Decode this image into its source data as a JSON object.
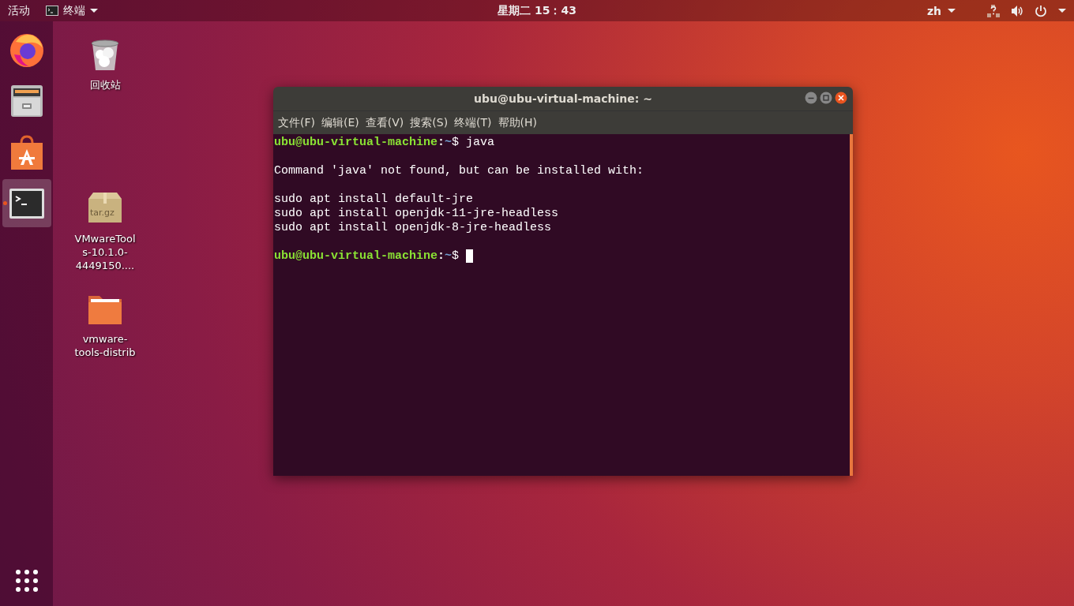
{
  "top_bar": {
    "activities": "活动",
    "app_menu": "终端",
    "clock": "星期二 15：43",
    "input_method": "zh"
  },
  "dock": {
    "items": [
      {
        "kind": "firefox",
        "selected": false,
        "running": false
      },
      {
        "kind": "files",
        "selected": false,
        "running": false
      },
      {
        "kind": "software",
        "selected": false,
        "running": false
      },
      {
        "kind": "terminal",
        "selected": true,
        "running": true
      }
    ]
  },
  "desktop_icons": [
    {
      "kind": "trash",
      "label": "回收站"
    },
    {
      "kind": "archive",
      "label": "VMwareTools-10.1.0-4449150....",
      "badge": "tar.gz"
    },
    {
      "kind": "folder",
      "label": "vmware-tools-distrib"
    }
  ],
  "terminal": {
    "title": "ubu@ubu-virtual-machine: ~",
    "menu": [
      "文件(F)",
      "编辑(E)",
      "查看(V)",
      "搜索(S)",
      "终端(T)",
      "帮助(H)"
    ],
    "lines": [
      {
        "kind": "prompt",
        "user": "ubu@ubu-virtual-machine",
        "sep": ":",
        "path": "~",
        "sigil": "$",
        "command": "java"
      },
      {
        "kind": "blank"
      },
      {
        "kind": "output",
        "text": "Command 'java' not found, but can be installed with:"
      },
      {
        "kind": "blank"
      },
      {
        "kind": "output",
        "text": "sudo apt install default-jre"
      },
      {
        "kind": "output",
        "text": "sudo apt install openjdk-11-jre-headless"
      },
      {
        "kind": "output",
        "text": "sudo apt install openjdk-8-jre-headless"
      },
      {
        "kind": "blank"
      },
      {
        "kind": "prompt",
        "user": "ubu@ubu-virtual-machine",
        "sep": ":",
        "path": "~",
        "sigil": "$",
        "cursor": true
      }
    ]
  }
}
